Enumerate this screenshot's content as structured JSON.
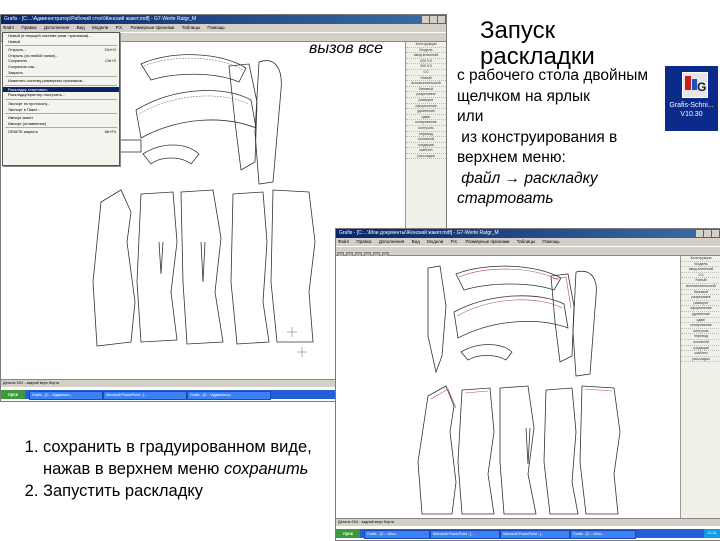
{
  "slide": {
    "title": "Запуск раскладки",
    "callout": "вызов все",
    "instr_line1": "с рабочего стола двойным",
    "instr_line2": "щелчком на ярлык",
    "instr_line3": "или",
    "instr_line4": " из конструирования в",
    "instr_line5": "верхнем меню:",
    "instr_line6": " файл → раскладку",
    "instr_line7": "стартовать",
    "step1_text": "сохранить в градуированном виде, нажав в верхнем меню ",
    "step1_italic": "сохранить",
    "step2_text": "Запустить раскладку"
  },
  "shortcut": {
    "label_line1": "Grafis-Schni...",
    "label_line2": "V10.30",
    "icon": "grafis-app-icon"
  },
  "window1": {
    "title": "Grafis - [C:...\\Администратор\\Рабочий стол\\Женский жакет.mdf] - G7-Werte Ratgr_M",
    "menu": [
      "Файл",
      "Правка",
      "Дополнения",
      "Вид",
      "Модели",
      "Р.Х.",
      "Размерные признаки",
      "Таблицы",
      "Помощь"
    ],
    "dropdown": [
      {
        "label": "Новый (в текущей системе разм. признаков)...",
        "shortcut": ""
      },
      {
        "label": "Новый",
        "shortcut": ""
      },
      {
        "label": "sep"
      },
      {
        "label": "Открыть...",
        "shortcut": "Ctrl+O"
      },
      {
        "label": "Открыть (из любой папки)...",
        "shortcut": ""
      },
      {
        "label": "Сохранить",
        "shortcut": "Ctrl+S"
      },
      {
        "label": "Сохранить как...",
        "shortcut": ""
      },
      {
        "label": "Закрыть",
        "shortcut": ""
      },
      {
        "label": "sep"
      },
      {
        "label": "Изменить систему размерных признаков...",
        "shortcut": ""
      },
      {
        "label": "sep"
      },
      {
        "label": "Раскладку стартовать",
        "shortcut": "",
        "highlight": true
      },
      {
        "label": "Раскладку/принтер настроить...",
        "shortcut": ""
      },
      {
        "label": "sep"
      },
      {
        "label": "Экспорт по протоколу...",
        "shortcut": ""
      },
      {
        "label": "Экспорт в Пакет...",
        "shortcut": ""
      },
      {
        "label": "sep"
      },
      {
        "label": "Импорт макет",
        "shortcut": ""
      },
      {
        "label": "Импорт (оглавление)",
        "shortcut": ""
      },
      {
        "label": "sep"
      },
      {
        "label": "GRAFIS закрыть",
        "shortcut": "Alt+F4"
      }
    ],
    "side_panel": [
      "Конструкция",
      "Модель",
      "ввод значений",
      "200 0.0",
      "300 0.0",
      "0.0",
      "Новый",
      "вспомогательный",
      "базовый",
      "разрезание",
      "разворот",
      "оформление",
      "удлинение",
      "сдвиг",
      "копирование",
      "контроль",
      "перевод",
      "основной",
      "градации",
      "шаблон",
      "раскладка"
    ],
    "status": "Деталь 004 - задний верх борта",
    "taskbar_start": "пуск",
    "taskbar_tasks": [
      "Grafis - [C:...\\Админист...",
      "Microsoft PowerPoint - [...",
      "Grafis - [C:...\\Администр..."
    ],
    "clock": "10:24"
  },
  "window2": {
    "title": "Grafis - [C:...\\Мои документы\\Женский жакет.mdf] - G7-Werte Ratgr_M",
    "menu": [
      "Файл",
      "Правка",
      "Дополнения",
      "Вид",
      "Модели",
      "Р.Х.",
      "Размерные признаки",
      "Таблицы",
      "Помощь"
    ],
    "side_panel": [
      "Конструкция",
      "Модель",
      "ввод значений",
      "0.0",
      "Новый",
      "вспомогательный",
      "базовый",
      "разрезание",
      "разворот",
      "оформление",
      "удлинение",
      "сдвиг",
      "копирование",
      "контроль",
      "перевод",
      "основной",
      "градации",
      "шаблон",
      "раскладка"
    ],
    "status": "Деталь 004 - задний верх борта",
    "taskbar_start": "пуск",
    "taskbar_tasks": [
      "Grafis - [C:...\\Мои...",
      "Microsoft PowerPoint - [...",
      "Microsoft PowerPoint - [...",
      "Grafis - [C:...\\Мои..."
    ],
    "clock": "10:31"
  }
}
